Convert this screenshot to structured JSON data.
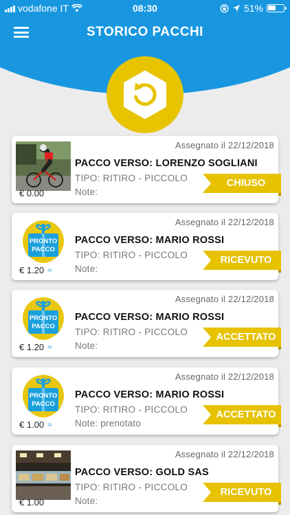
{
  "status_bar": {
    "carrier": "vodafone IT",
    "time": "08:30",
    "battery": "51%",
    "battery_level": 0.51
  },
  "header": {
    "title": "STORICO PACCHI",
    "icon": "history-icon",
    "colors": {
      "primary": "#1897e0",
      "accent": "#e7c300"
    }
  },
  "packages": [
    {
      "thumb": "cyclist-photo",
      "price": "€ 0.00",
      "show_wave": false,
      "assigned": "Assegnato il 22/12/2018",
      "dest": "PACCO VERSO: LORENZO SOGLIANI",
      "tipo": "TIPO: RITIRO - PICCOLO",
      "note": "Note:",
      "status": "CHIUSO"
    },
    {
      "thumb": "pronto-pacco-logo",
      "price": "€ 1.20",
      "show_wave": true,
      "assigned": "Assegnato il 22/12/2018",
      "dest": "PACCO VERSO: MARIO ROSSI",
      "tipo": "TIPO: RITIRO - PICCOLO",
      "note": "Note:",
      "status": "RICEVUTO"
    },
    {
      "thumb": "pronto-pacco-logo",
      "price": "€ 1.20",
      "show_wave": true,
      "assigned": "Assegnato il 22/12/2018",
      "dest": "PACCO VERSO: MARIO ROSSI",
      "tipo": "TIPO: RITIRO - PICCOLO",
      "note": "Note:",
      "status": "ACCETTATO"
    },
    {
      "thumb": "pronto-pacco-logo",
      "price": "€ 1.00",
      "show_wave": true,
      "assigned": "Assegnato il 22/12/2018",
      "dest": "PACCO VERSO: MARIO ROSSI",
      "tipo": "TIPO: RITIRO - PICCOLO",
      "note": "Note: prenotato",
      "status": "ACCETTATO"
    },
    {
      "thumb": "shop-photo",
      "price": "€ 1.00",
      "show_wave": false,
      "assigned": "Assegnato il 22/12/2018",
      "dest": "PACCO VERSO: GOLD SAS",
      "tipo": "TIPO: RITIRO - PICCOLO",
      "note": "Note:",
      "status": "RICEVUTO"
    }
  ]
}
